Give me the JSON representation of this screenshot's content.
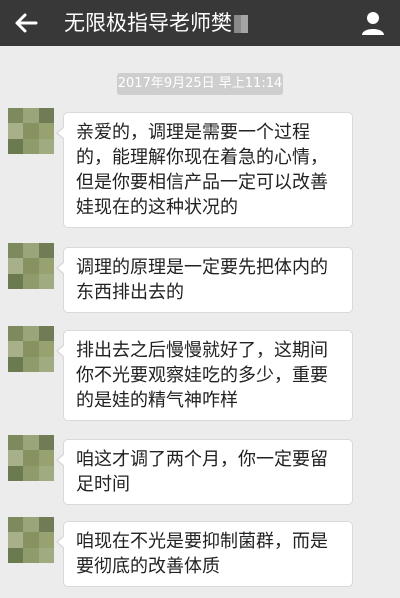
{
  "header": {
    "title": "无限极指导老师樊",
    "back_icon": "arrow-left-icon",
    "profile_icon": "person-icon",
    "background": "#383838"
  },
  "chat": {
    "timestamp": "2017年9月25日 早上11:14",
    "messages": [
      {
        "text": "亲爱的，调理是需要一个过程的，能理解你现在着急的心情，但是你要相信产品一定可以改善娃现在的这种状况的"
      },
      {
        "text": "调理的原理是一定要先把体内的东西排出去的"
      },
      {
        "text": "排出去之后慢慢就好了，这期间你不光要观察娃吃的多少，重要的是娃的精气神咋样"
      },
      {
        "text": "咱这才调了两个月，你一定要留足时间"
      },
      {
        "text": "咱现在不光是要抑制菌群，而是要彻底的改善体质"
      }
    ]
  }
}
